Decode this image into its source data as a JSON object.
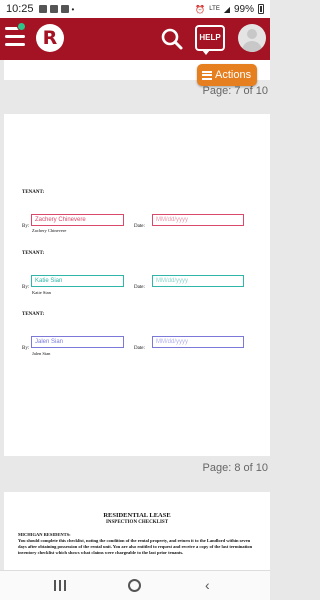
{
  "status_bar": {
    "time": "10:25",
    "signal": "LTE",
    "battery": "99%"
  },
  "app_bar": {
    "logo_letter": "R",
    "help_label": "HELP"
  },
  "actions_button": {
    "label": "Actions"
  },
  "pages": {
    "page7_label": "Page: 7 of 10",
    "page8_label": "Page: 8 of 10"
  },
  "signature_blocks": [
    {
      "heading": "TENANT:",
      "by_label": "By:",
      "signature_value": "Zachery Chinevere",
      "date_label": "Date:",
      "date_placeholder": "MM/dd/yyyy",
      "printed_name": "Zachery Chinevere",
      "color": "#d94a6a"
    },
    {
      "heading": "TENANT:",
      "by_label": "By:",
      "signature_value": "Katie Sian",
      "date_label": "Date:",
      "date_placeholder": "MM/dd/yyyy",
      "printed_name": "Katie Sian",
      "color": "#2fb6a8"
    },
    {
      "heading": "TENANT:",
      "by_label": "By:",
      "signature_value": "Jalen Sian",
      "date_label": "Date:",
      "date_placeholder": "MM/dd/yyyy",
      "printed_name": "Jalen Sian",
      "color": "#7b78d8"
    }
  ],
  "next_doc": {
    "title": "RESIDENTIAL LEASE",
    "subtitle": "INSPECTION CHECKLIST",
    "section_heading": "MICHIGAN RESIDENTS:",
    "body": "You should complete this checklist, noting the condition of the rental property, and return it to the Landlord within seven days after obtaining possession of the rental unit. You are also entitled to request and receive a copy of the last termination inventory checklist which shows what claims were chargeable to the last prior tenants."
  }
}
